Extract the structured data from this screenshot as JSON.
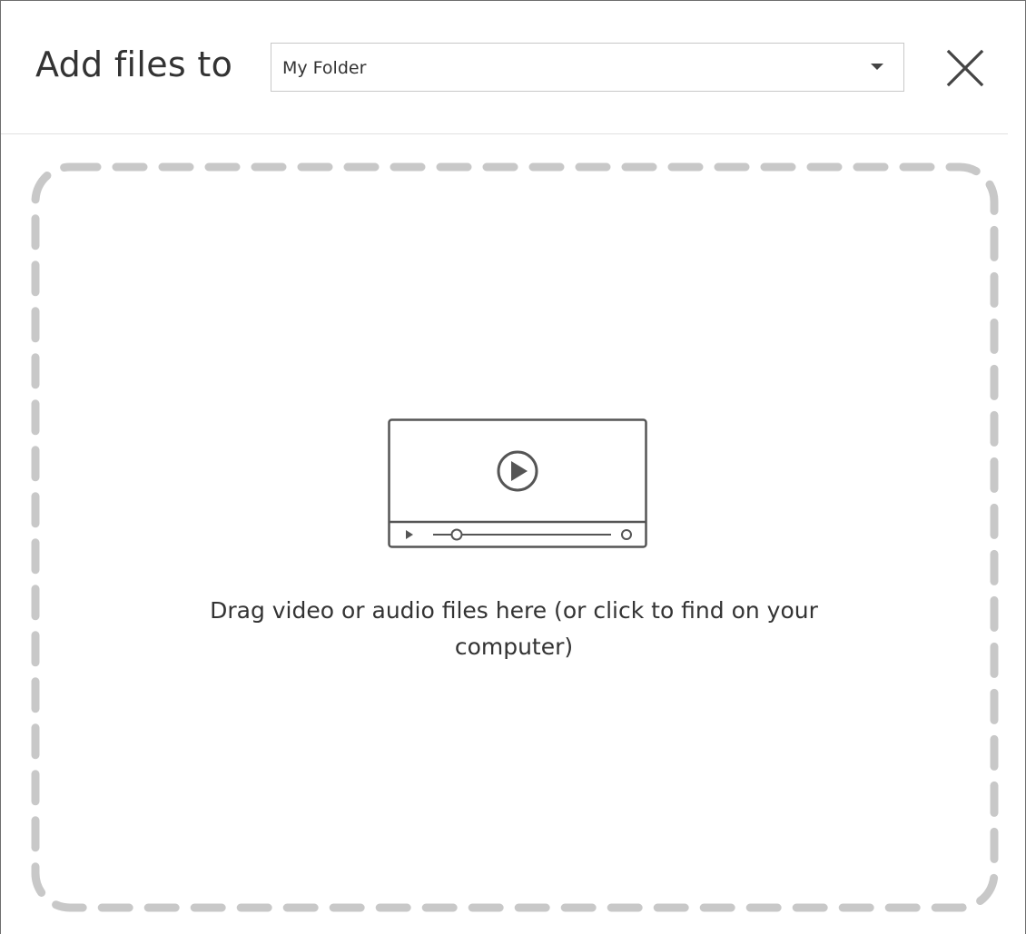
{
  "header": {
    "title": "Add files to",
    "folder_select": {
      "selected": "My Folder"
    },
    "close_icon": "close-icon"
  },
  "dropzone": {
    "icon": "video-player-icon",
    "text": "Drag video or audio files here (or click to find on your computer)"
  },
  "colors": {
    "border": "#6e6e6e",
    "divider": "#e1e1e1",
    "dash": "#c8c8c8",
    "text": "#333333",
    "icon_stroke": "#555555"
  }
}
